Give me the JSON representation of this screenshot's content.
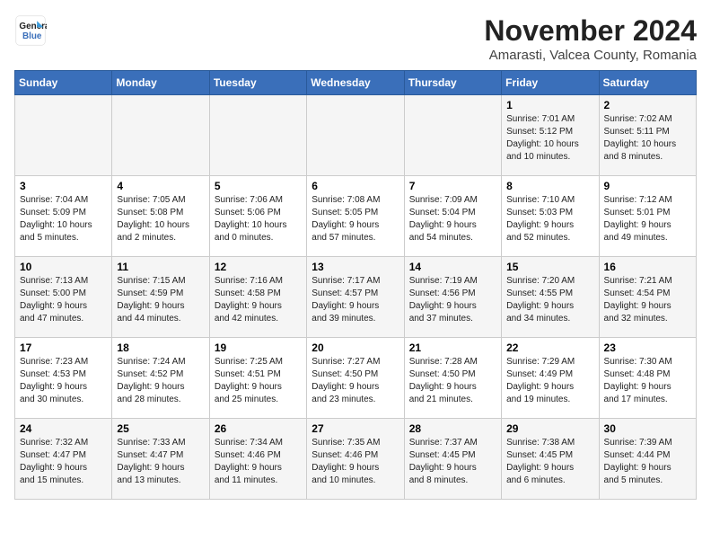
{
  "header": {
    "logo_line1": "General",
    "logo_line2": "Blue",
    "title": "November 2024",
    "subtitle": "Amarasti, Valcea County, Romania"
  },
  "weekdays": [
    "Sunday",
    "Monday",
    "Tuesday",
    "Wednesday",
    "Thursday",
    "Friday",
    "Saturday"
  ],
  "weeks": [
    [
      {
        "day": "",
        "detail": ""
      },
      {
        "day": "",
        "detail": ""
      },
      {
        "day": "",
        "detail": ""
      },
      {
        "day": "",
        "detail": ""
      },
      {
        "day": "",
        "detail": ""
      },
      {
        "day": "1",
        "detail": "Sunrise: 7:01 AM\nSunset: 5:12 PM\nDaylight: 10 hours\nand 10 minutes."
      },
      {
        "day": "2",
        "detail": "Sunrise: 7:02 AM\nSunset: 5:11 PM\nDaylight: 10 hours\nand 8 minutes."
      }
    ],
    [
      {
        "day": "3",
        "detail": "Sunrise: 7:04 AM\nSunset: 5:09 PM\nDaylight: 10 hours\nand 5 minutes."
      },
      {
        "day": "4",
        "detail": "Sunrise: 7:05 AM\nSunset: 5:08 PM\nDaylight: 10 hours\nand 2 minutes."
      },
      {
        "day": "5",
        "detail": "Sunrise: 7:06 AM\nSunset: 5:06 PM\nDaylight: 10 hours\nand 0 minutes."
      },
      {
        "day": "6",
        "detail": "Sunrise: 7:08 AM\nSunset: 5:05 PM\nDaylight: 9 hours\nand 57 minutes."
      },
      {
        "day": "7",
        "detail": "Sunrise: 7:09 AM\nSunset: 5:04 PM\nDaylight: 9 hours\nand 54 minutes."
      },
      {
        "day": "8",
        "detail": "Sunrise: 7:10 AM\nSunset: 5:03 PM\nDaylight: 9 hours\nand 52 minutes."
      },
      {
        "day": "9",
        "detail": "Sunrise: 7:12 AM\nSunset: 5:01 PM\nDaylight: 9 hours\nand 49 minutes."
      }
    ],
    [
      {
        "day": "10",
        "detail": "Sunrise: 7:13 AM\nSunset: 5:00 PM\nDaylight: 9 hours\nand 47 minutes."
      },
      {
        "day": "11",
        "detail": "Sunrise: 7:15 AM\nSunset: 4:59 PM\nDaylight: 9 hours\nand 44 minutes."
      },
      {
        "day": "12",
        "detail": "Sunrise: 7:16 AM\nSunset: 4:58 PM\nDaylight: 9 hours\nand 42 minutes."
      },
      {
        "day": "13",
        "detail": "Sunrise: 7:17 AM\nSunset: 4:57 PM\nDaylight: 9 hours\nand 39 minutes."
      },
      {
        "day": "14",
        "detail": "Sunrise: 7:19 AM\nSunset: 4:56 PM\nDaylight: 9 hours\nand 37 minutes."
      },
      {
        "day": "15",
        "detail": "Sunrise: 7:20 AM\nSunset: 4:55 PM\nDaylight: 9 hours\nand 34 minutes."
      },
      {
        "day": "16",
        "detail": "Sunrise: 7:21 AM\nSunset: 4:54 PM\nDaylight: 9 hours\nand 32 minutes."
      }
    ],
    [
      {
        "day": "17",
        "detail": "Sunrise: 7:23 AM\nSunset: 4:53 PM\nDaylight: 9 hours\nand 30 minutes."
      },
      {
        "day": "18",
        "detail": "Sunrise: 7:24 AM\nSunset: 4:52 PM\nDaylight: 9 hours\nand 28 minutes."
      },
      {
        "day": "19",
        "detail": "Sunrise: 7:25 AM\nSunset: 4:51 PM\nDaylight: 9 hours\nand 25 minutes."
      },
      {
        "day": "20",
        "detail": "Sunrise: 7:27 AM\nSunset: 4:50 PM\nDaylight: 9 hours\nand 23 minutes."
      },
      {
        "day": "21",
        "detail": "Sunrise: 7:28 AM\nSunset: 4:50 PM\nDaylight: 9 hours\nand 21 minutes."
      },
      {
        "day": "22",
        "detail": "Sunrise: 7:29 AM\nSunset: 4:49 PM\nDaylight: 9 hours\nand 19 minutes."
      },
      {
        "day": "23",
        "detail": "Sunrise: 7:30 AM\nSunset: 4:48 PM\nDaylight: 9 hours\nand 17 minutes."
      }
    ],
    [
      {
        "day": "24",
        "detail": "Sunrise: 7:32 AM\nSunset: 4:47 PM\nDaylight: 9 hours\nand 15 minutes."
      },
      {
        "day": "25",
        "detail": "Sunrise: 7:33 AM\nSunset: 4:47 PM\nDaylight: 9 hours\nand 13 minutes."
      },
      {
        "day": "26",
        "detail": "Sunrise: 7:34 AM\nSunset: 4:46 PM\nDaylight: 9 hours\nand 11 minutes."
      },
      {
        "day": "27",
        "detail": "Sunrise: 7:35 AM\nSunset: 4:46 PM\nDaylight: 9 hours\nand 10 minutes."
      },
      {
        "day": "28",
        "detail": "Sunrise: 7:37 AM\nSunset: 4:45 PM\nDaylight: 9 hours\nand 8 minutes."
      },
      {
        "day": "29",
        "detail": "Sunrise: 7:38 AM\nSunset: 4:45 PM\nDaylight: 9 hours\nand 6 minutes."
      },
      {
        "day": "30",
        "detail": "Sunrise: 7:39 AM\nSunset: 4:44 PM\nDaylight: 9 hours\nand 5 minutes."
      }
    ]
  ]
}
